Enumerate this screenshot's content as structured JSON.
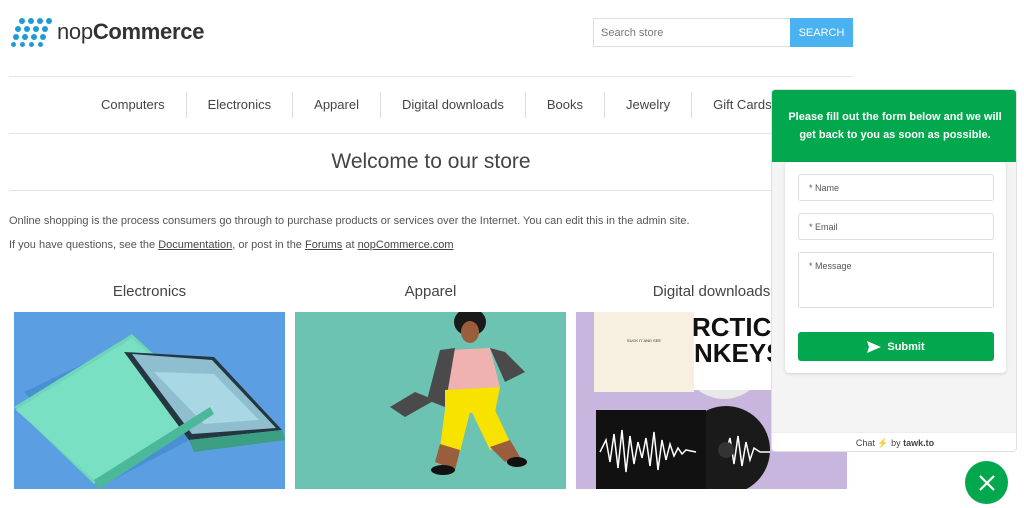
{
  "brand": {
    "logo_plain": "nop",
    "logo_bold": "Commerce",
    "logo_color": "#1e9bd7"
  },
  "search": {
    "placeholder": "Search store",
    "button_label": "SEARCH",
    "button_color": "#4ab2f1"
  },
  "menu": {
    "items": [
      {
        "label": "Computers"
      },
      {
        "label": "Electronics"
      },
      {
        "label": "Apparel"
      },
      {
        "label": "Digital downloads"
      },
      {
        "label": "Books"
      },
      {
        "label": "Jewelry"
      },
      {
        "label": "Gift Cards"
      }
    ]
  },
  "main": {
    "title": "Welcome to our store",
    "intro_line1": "Online shopping is the process consumers go through to purchase products or services over the Internet. You can edit this in the admin site.",
    "intro_line2_prefix": "If you have questions, see the ",
    "documentation_link": "Documentation",
    "intro_line2_middle": ", or post in the ",
    "forums_link": "Forums",
    "intro_line2_at": " at ",
    "site_link": "nopCommerce.com"
  },
  "categories": [
    {
      "title": "Electronics",
      "image": "green-smartphone-image"
    },
    {
      "title": "Apparel",
      "image": "jumping-woman-image"
    },
    {
      "title": "Digital downloads",
      "image": "vinyl-records-image"
    }
  ],
  "album_texts": {
    "small_cover": "SUCK IT AND SEE",
    "big_cover_line1": "RCTIC",
    "big_cover_line2": "NKEYS"
  },
  "chat": {
    "header": "Please fill out the form below and we will get back to you as soon as possible.",
    "name_label": "* Name",
    "email_label": "* Email",
    "message_label": "* Message",
    "submit_label": "Submit",
    "footer_chat": "Chat",
    "footer_by": " by ",
    "footer_brand": "tawk.to",
    "accent_color": "#03a84e"
  }
}
